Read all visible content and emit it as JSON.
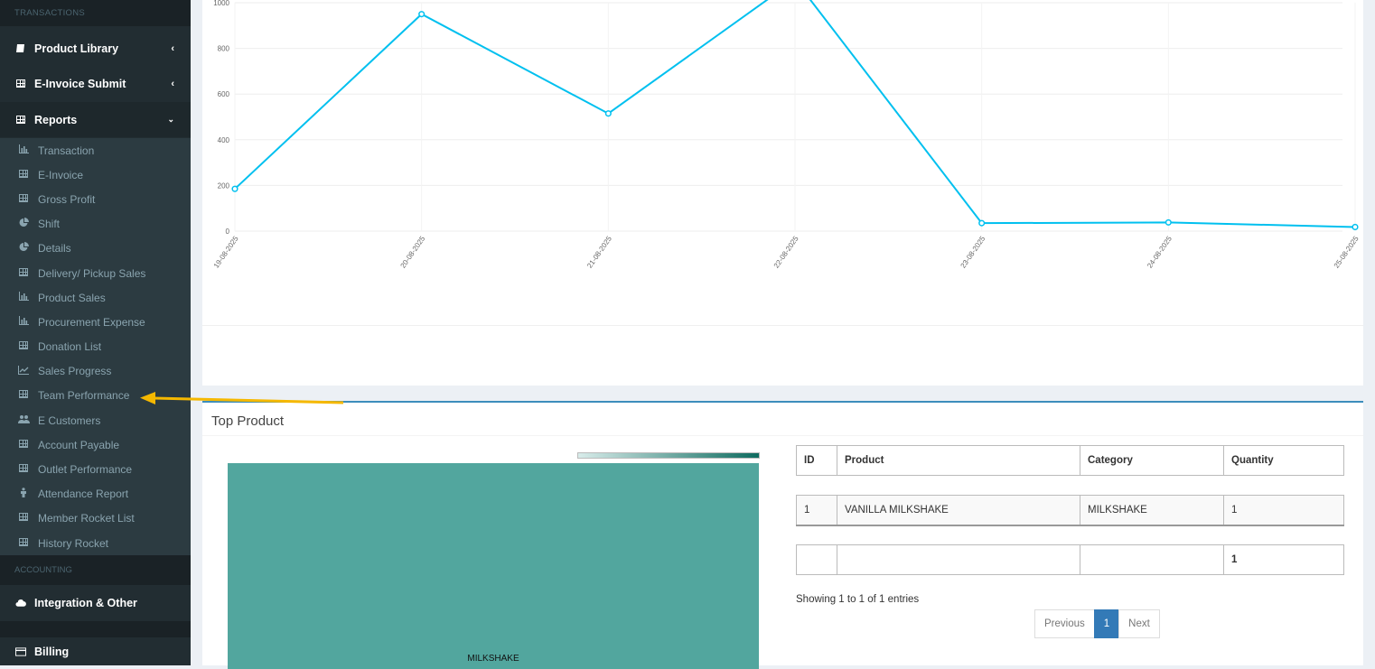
{
  "sidebar": {
    "section_transactions": "TRANSACTIONS",
    "section_accounting": "ACCOUNTING",
    "product_library": "Product Library",
    "einvoice_submit": "E-Invoice Submit",
    "reports": "Reports",
    "integration": "Integration & Other",
    "billing": "Billing",
    "report_items": [
      {
        "label": "Transaction",
        "icon": "bar-chart-icon"
      },
      {
        "label": "E-Invoice",
        "icon": "table-icon"
      },
      {
        "label": "Gross Profit",
        "icon": "table-icon"
      },
      {
        "label": "Shift",
        "icon": "pie-chart-icon"
      },
      {
        "label": "Details",
        "icon": "pie-chart-icon"
      },
      {
        "label": "Delivery/ Pickup Sales",
        "icon": "table-icon"
      },
      {
        "label": "Product Sales",
        "icon": "bar-chart-icon"
      },
      {
        "label": "Procurement Expense",
        "icon": "bar-chart-icon"
      },
      {
        "label": "Donation List",
        "icon": "table-icon"
      },
      {
        "label": "Sales Progress",
        "icon": "line-chart-icon"
      },
      {
        "label": "Team Performance",
        "icon": "table-icon"
      },
      {
        "label": "E Customers",
        "icon": "users-icon"
      },
      {
        "label": "Account Payable",
        "icon": "table-icon"
      },
      {
        "label": "Outlet Performance",
        "icon": "table-icon"
      },
      {
        "label": "Attendance Report",
        "icon": "person-icon"
      },
      {
        "label": "Member Rocket List",
        "icon": "table-icon"
      },
      {
        "label": "History Rocket",
        "icon": "table-icon"
      }
    ]
  },
  "chart_data": {
    "type": "line",
    "categories": [
      "19-08-2025",
      "20-08-2025",
      "21-08-2025",
      "22-08-2025",
      "23-08-2025",
      "24-08-2025",
      "25-08-2025"
    ],
    "series": [
      {
        "values": [
          185,
          950,
          515,
          1100,
          35,
          38,
          18
        ]
      }
    ],
    "y_ticks": [
      "0",
      "200",
      "400",
      "600",
      "800",
      "1000"
    ],
    "ylim": [
      0,
      1000
    ],
    "line_color": "#00c0ef",
    "grid": true
  },
  "top_product": {
    "title": "Top Product",
    "treemap_label": "MILKSHAKE",
    "treemap_color": "#52a69e",
    "headers": [
      "ID",
      "Product",
      "Category",
      "Quantity"
    ],
    "row": [
      "1",
      "VANILLA MILKSHAKE",
      "MILKSHAKE",
      "1"
    ],
    "total_row": [
      "",
      "",
      "",
      "1"
    ],
    "info": "Showing 1 to 1 of 1 entries",
    "pager": {
      "previous": "Previous",
      "current": "1",
      "next": "Next"
    }
  },
  "annotation_arrow_color": "#f5b800"
}
